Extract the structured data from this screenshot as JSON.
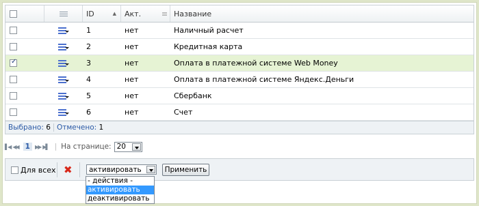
{
  "grid": {
    "columns": {
      "id": "ID",
      "active": "Акт.",
      "name": "Название"
    },
    "rows": [
      {
        "id": "1",
        "active": "нет",
        "name": "Наличный расчет",
        "checked": false
      },
      {
        "id": "2",
        "active": "нет",
        "name": "Кредитная карта",
        "checked": false
      },
      {
        "id": "3",
        "active": "нет",
        "name": "Оплата в платежной системе Web Money",
        "checked": true
      },
      {
        "id": "4",
        "active": "нет",
        "name": "Оплата в платежной системе Яндекс.Деньги",
        "checked": false
      },
      {
        "id": "5",
        "active": "нет",
        "name": "Сбербанк",
        "checked": false
      },
      {
        "id": "6",
        "active": "нет",
        "name": "Счет",
        "checked": false
      }
    ],
    "highlight_color": "#e6f3d4"
  },
  "summary": {
    "selected_label": "Выбрано:",
    "selected_count": "6",
    "checked_label": "Отмечено:",
    "checked_count": "1"
  },
  "pager": {
    "current_page": "1",
    "per_page_label": "На странице:",
    "per_page_value": "20",
    "first_icon": "first-page-icon",
    "prev_icon": "prev-page-icon",
    "next_icon": "next-page-icon",
    "last_icon": "last-page-icon"
  },
  "footer": {
    "for_all_label": "Для всех",
    "action_selected": "активировать",
    "apply_label": "Применить",
    "delete_icon": "delete-x-icon",
    "delete_color": "#d8281a"
  },
  "action_dropdown": {
    "options": [
      "- действия -",
      "активировать",
      "деактивировать"
    ],
    "highlighted_index": 1,
    "highlight_color": "#3399ff"
  }
}
